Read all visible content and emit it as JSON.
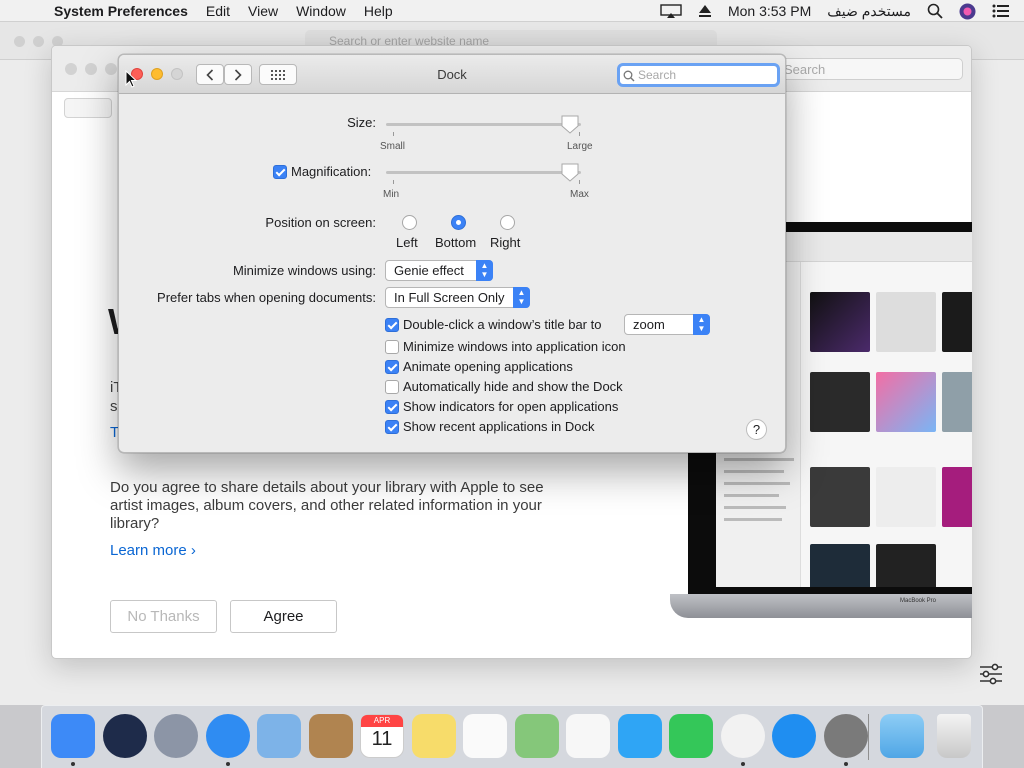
{
  "menubar": {
    "app": "System Preferences",
    "items": [
      "Edit",
      "View",
      "Window",
      "Help"
    ],
    "clock": "Mon 3:53 PM",
    "user": "مستخدم ضيف"
  },
  "safari": {
    "address_placeholder": "Search or enter website name"
  },
  "itunes": {
    "search_placeholder": "Search",
    "heading_fragment": "W",
    "line1_fragment": "iT",
    "line2_fragment": "sl",
    "link_fragment": "T",
    "question": "Do you agree to share details about your library with Apple to see artist images, album covers, and other related information in your library?",
    "learn_more": "Learn more",
    "no_thanks": "No Thanks",
    "agree": "Agree",
    "laptop_label": "MacBook Pro"
  },
  "prefs": {
    "title": "Dock",
    "search_placeholder": "Search",
    "size": {
      "label": "Size:",
      "min": "Small",
      "max": "Large",
      "value": 1.0
    },
    "magnification": {
      "label": "Magnification:",
      "checked": true,
      "min": "Min",
      "max": "Max",
      "value": 1.0
    },
    "position": {
      "label": "Position on screen:",
      "options": [
        "Left",
        "Bottom",
        "Right"
      ],
      "selected": "Bottom"
    },
    "minimize": {
      "label": "Minimize windows using:",
      "value": "Genie effect"
    },
    "tabs": {
      "label": "Prefer tabs when opening documents:",
      "value": "In Full Screen Only"
    },
    "doubleclick": {
      "label": "Double-click a window’s title bar to",
      "checked": true,
      "value": "zoom"
    },
    "options": [
      {
        "label": "Minimize windows into application icon",
        "checked": false
      },
      {
        "label": "Animate opening applications",
        "checked": true
      },
      {
        "label": "Automatically hide and show the Dock",
        "checked": false
      },
      {
        "label": "Show indicators for open applications",
        "checked": true
      },
      {
        "label": "Show recent applications in Dock",
        "checked": true
      }
    ],
    "help": "?"
  },
  "dock": {
    "apps": [
      {
        "name": "finder-icon",
        "color": "#3d8af7",
        "running": true
      },
      {
        "name": "siri-icon",
        "color": "#1e2b4a",
        "running": false
      },
      {
        "name": "launchpad-icon",
        "color": "#8c95a6",
        "running": false
      },
      {
        "name": "safari-icon",
        "color": "#2f8cf2",
        "running": true
      },
      {
        "name": "mail-icon",
        "color": "#7db3e8",
        "running": false
      },
      {
        "name": "contacts-icon",
        "color": "#b08450",
        "running": false
      },
      {
        "name": "calendar-icon",
        "color": "#ffffff",
        "running": false
      },
      {
        "name": "notes-icon",
        "color": "#f7dc6a",
        "running": false
      },
      {
        "name": "reminders-icon",
        "color": "#fafafa",
        "running": false
      },
      {
        "name": "maps-icon",
        "color": "#85c77a",
        "running": false
      },
      {
        "name": "photos-icon",
        "color": "#f7f7f7",
        "running": false
      },
      {
        "name": "messages-icon",
        "color": "#2fa5f5",
        "running": false
      },
      {
        "name": "facetime-icon",
        "color": "#34c759",
        "running": false
      },
      {
        "name": "itunes-icon",
        "color": "#f2f2f2",
        "running": true
      },
      {
        "name": "app-store-icon",
        "color": "#1f8ef1",
        "running": false
      },
      {
        "name": "system-preferences-icon",
        "color": "#7a7a7a",
        "running": true
      }
    ],
    "calendar_month": "APR",
    "calendar_day": "11"
  }
}
